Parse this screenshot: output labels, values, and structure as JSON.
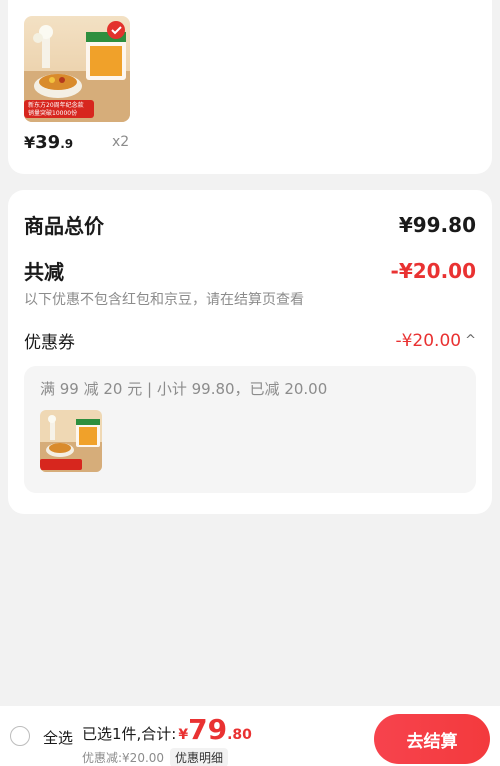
{
  "product": {
    "price_symbol": "¥",
    "price_int": "39",
    "price_dec": ".9",
    "quantity": "x2",
    "image_caption_line1": "新东方20周年纪念款",
    "image_caption_line2": "销量突破10000份"
  },
  "summary": {
    "total_label": "商品总价",
    "total_value": "¥99.80",
    "discount_label": "共减",
    "discount_value": "-¥20.00",
    "discount_note": "以下优惠不包含红包和京豆，请在结算页查看",
    "coupon_label": "优惠券",
    "coupon_value": "-¥20.00",
    "coupon_detail": "满 99 减 20 元 | 小计 99.80，已减 20.00"
  },
  "bottom": {
    "select_all": "全选",
    "selected_text": "已选1件,合计:",
    "total_symbol": "¥",
    "total_int": "79",
    "total_dec": ".80",
    "discount_text": "优惠减:¥20.00",
    "detail_button": "优惠明细",
    "checkout_button": "去结算"
  },
  "colors": {
    "accent_red": "#e93232",
    "background": "#f2f2f2"
  }
}
